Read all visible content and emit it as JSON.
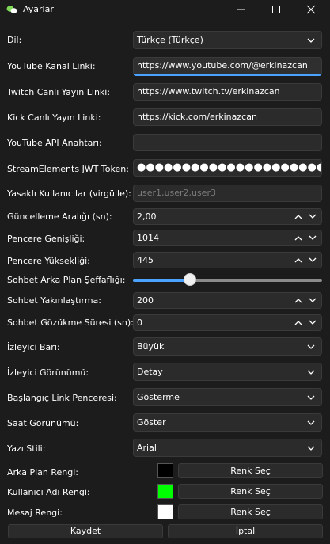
{
  "window": {
    "title": "Ayarlar",
    "controls": [
      "minimize-icon",
      "maximize-icon",
      "close-icon"
    ]
  },
  "settings": {
    "language": {
      "label": "Dil:",
      "value": "Türkçe (Türkçe)"
    },
    "youtube_channel": {
      "label": "YouTube Kanal Linki:",
      "value": "https://www.youtube.com/@erkinazcan"
    },
    "twitch_link": {
      "label": "Twitch Canlı Yayın Linki:",
      "value": "https://www.twitch.tv/erkinazcan"
    },
    "kick_link": {
      "label": "Kick Canlı Yayın Linki:",
      "value": "https://kick.com/erkinazcan"
    },
    "youtube_api_key": {
      "label": "YouTube API Anahtarı:",
      "value": ""
    },
    "streamelements_token": {
      "label": "StreamElements JWT Token:",
      "value": "●●●●●●●●●●●●●●●●●●●●●●●●●●●●●●●●●●●●●●●●●●●●"
    },
    "banned_users": {
      "label": "Yasaklı Kullanıcılar (virgülle):",
      "placeholder": "user1,user2,user3"
    },
    "update_interval": {
      "label": "Güncelleme Aralığı (sn):",
      "value": "2,00"
    },
    "window_width": {
      "label": "Pencere Genişliği:",
      "value": "1014"
    },
    "window_height": {
      "label": "Pencere Yüksekliği:",
      "value": "445"
    },
    "chat_opacity": {
      "label": "Sohbet Arka Plan Şeffaflığı:",
      "level": 0.3
    },
    "chat_zoom": {
      "label": "Sohbet Yakınlaştırma:",
      "value": "200"
    },
    "chat_display_time": {
      "label": "Sohbet Gözükme Süresi (sn):",
      "value": "0"
    },
    "viewer_bar": {
      "label": "İzleyici Barı:",
      "value": "Büyük"
    },
    "viewer_view": {
      "label": "İzleyici Görünümü:",
      "value": "Detay"
    },
    "startup_link_window": {
      "label": "Başlangıç Link Penceresi:",
      "value": "Gösterme"
    },
    "clock_view": {
      "label": "Saat Görünümü:",
      "value": "Göster"
    },
    "font_style": {
      "label": "Yazı Stili:",
      "value": "Arial"
    },
    "bg_color": {
      "label": "Arka Plan Rengi:",
      "color": "#000000",
      "button": "Renk Seç"
    },
    "username_color": {
      "label": "Kullanıcı Adı Rengi:",
      "color": "#00ff00",
      "button": "Renk Seç"
    },
    "message_color": {
      "label": "Mesaj Rengi:",
      "color": "#ffffff",
      "button": "Renk Seç"
    }
  },
  "actions": {
    "save": "Kaydet",
    "cancel": "İptal"
  },
  "theme": {
    "accent": "#4aa3ff",
    "background": "#1c1c1c",
    "field": "#2b2b2b"
  }
}
